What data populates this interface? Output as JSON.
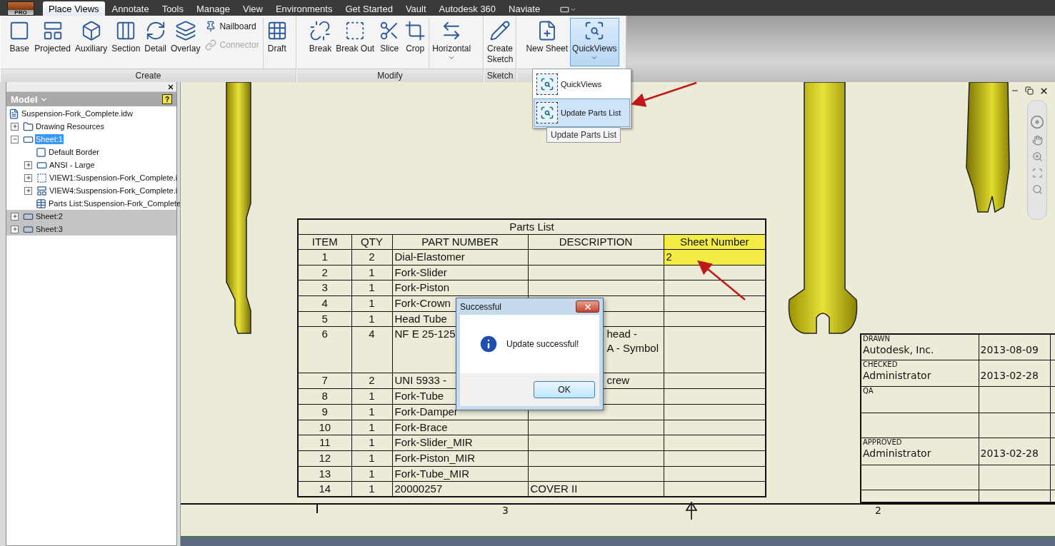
{
  "app_button": {
    "label": "PRO"
  },
  "tabs": [
    {
      "label": "Place Views",
      "selected": true
    },
    {
      "label": "Annotate",
      "selected": false
    },
    {
      "label": "Tools",
      "selected": false
    },
    {
      "label": "Manage",
      "selected": false
    },
    {
      "label": "View",
      "selected": false
    },
    {
      "label": "Environments",
      "selected": false
    },
    {
      "label": "Get Started",
      "selected": false
    },
    {
      "label": "Vault",
      "selected": false
    },
    {
      "label": "Autodesk 360",
      "selected": false
    },
    {
      "label": "Naviate",
      "selected": false
    }
  ],
  "ribbon": {
    "panels": [
      {
        "label": "Create",
        "groups": [
          [
            {
              "label": "Base",
              "kind": "large",
              "pressed": false,
              "disabled": false,
              "dropdown": false
            },
            {
              "label": "Projected",
              "kind": "large",
              "pressed": false,
              "disabled": false,
              "dropdown": false
            },
            {
              "label": "Auxiliary",
              "kind": "large",
              "pressed": false,
              "disabled": false,
              "dropdown": false
            },
            {
              "label": "Section",
              "kind": "large",
              "pressed": false,
              "disabled": false,
              "dropdown": false
            },
            {
              "label": "Detail",
              "kind": "large",
              "pressed": false,
              "disabled": false,
              "dropdown": false
            },
            {
              "label": "Overlay",
              "kind": "large",
              "pressed": false,
              "disabled": false,
              "dropdown": false
            },
            {
              "label": "Nailboard",
              "kind": "small",
              "pressed": false,
              "disabled": false,
              "dropdown": false
            },
            {
              "label": "Connector",
              "kind": "small",
              "pressed": false,
              "disabled": true,
              "dropdown": false
            }
          ],
          [
            {
              "label": "Draft",
              "kind": "large",
              "pressed": false,
              "disabled": false,
              "dropdown": false
            }
          ]
        ]
      },
      {
        "label": "Modify",
        "groups": [
          [
            {
              "label": "Break",
              "kind": "large",
              "pressed": false,
              "disabled": false,
              "dropdown": false
            },
            {
              "label": "Break Out",
              "kind": "large",
              "pressed": false,
              "disabled": false,
              "dropdown": false
            },
            {
              "label": "Slice",
              "kind": "large",
              "pressed": false,
              "disabled": false,
              "dropdown": false
            },
            {
              "label": "Crop",
              "kind": "large",
              "pressed": false,
              "disabled": false,
              "dropdown": false
            }
          ],
          [
            {
              "label": "Horizontal",
              "kind": "large",
              "pressed": false,
              "disabled": false,
              "dropdown": true
            }
          ]
        ]
      },
      {
        "label": "Sketch",
        "groups": [
          [
            {
              "label": "Create\nSketch",
              "kind": "large",
              "pressed": false,
              "disabled": false,
              "dropdown": false
            }
          ]
        ]
      },
      {
        "groups": [
          [
            {
              "label": "New Sheet",
              "kind": "large",
              "pressed": false,
              "disabled": false,
              "dropdown": false
            },
            {
              "label": "QuickViews",
              "kind": "large",
              "pressed": true,
              "disabled": false,
              "dropdown": true
            }
          ]
        ]
      }
    ]
  },
  "quickviews_menu": {
    "items": [
      {
        "label": "QuickViews",
        "selected": false
      },
      {
        "label": "Update Parts List",
        "selected": true
      }
    ],
    "tooltip": "Update Parts List"
  },
  "browser": {
    "title": "Model",
    "help": "?",
    "tree": [
      {
        "label": "Suspension-Fork_Complete.idw",
        "kind": "document",
        "selected": false,
        "children": [
          {
            "label": "Drawing Resources",
            "kind": "folder",
            "selected": false,
            "expanded": false,
            "inactive": false
          },
          {
            "label": "Sheet:1",
            "kind": "sheet",
            "selected": true,
            "expanded": true,
            "inactive": false,
            "children": [
              {
                "label": "Default Border",
                "kind": "border",
                "selected": false
              },
              {
                "label": "ANSI - Large",
                "kind": "titleblock",
                "selected": false,
                "expanded": false
              },
              {
                "label": "VIEW1:Suspension-Fork_Complete.i",
                "kind": "view",
                "selected": false,
                "expanded": false
              },
              {
                "label": "VIEW4:Suspension-Fork_Complete.i",
                "kind": "projected",
                "selected": false,
                "expanded": false
              },
              {
                "label": "Parts List:Suspension-Fork_Complete",
                "kind": "partslist",
                "selected": false
              }
            ]
          },
          {
            "label": "Sheet:2",
            "kind": "sheet",
            "selected": false,
            "expanded": false,
            "inactive": true
          },
          {
            "label": "Sheet:3",
            "kind": "sheet",
            "selected": false,
            "expanded": false,
            "inactive": true
          }
        ]
      }
    ]
  },
  "parts_list": {
    "title": "Parts List",
    "columns": [
      {
        "label": "ITEM",
        "highlighted": false
      },
      {
        "label": "QTY",
        "highlighted": false
      },
      {
        "label": "PART NUMBER",
        "highlighted": false
      },
      {
        "label": "DESCRIPTION",
        "highlighted": false
      },
      {
        "label": "Sheet Number",
        "highlighted": true
      }
    ],
    "rows": [
      {
        "item": "1",
        "qty": "2",
        "part_number": "Dial-Elastomer",
        "sheet_number": "2",
        "highlighted": true
      },
      {
        "item": "2",
        "qty": "1",
        "part_number": "Fork-Slider",
        "highlighted": false
      },
      {
        "item": "3",
        "qty": "1",
        "part_number": "Fork-Piston",
        "highlighted": false
      },
      {
        "item": "4",
        "qty": "1",
        "part_number": "Fork-Crown",
        "highlighted": false
      },
      {
        "item": "5",
        "qty": "1",
        "part_number": "Head Tube",
        "highlighted": false
      },
      {
        "item": "6",
        "qty": "4",
        "part_number": "NF E 25-125",
        "description": "head -\nA - Symbol",
        "highlighted": false,
        "partly_hidden": true
      },
      {
        "item": "7",
        "qty": "2",
        "part_number": "UNI 5933 -",
        "description": "crew",
        "highlighted": false,
        "partly_hidden": true
      },
      {
        "item": "8",
        "qty": "1",
        "part_number": "Fork-Tube",
        "highlighted": false
      },
      {
        "item": "9",
        "qty": "1",
        "part_number": "Fork-Damper",
        "highlighted": false
      },
      {
        "item": "10",
        "qty": "1",
        "part_number": "Fork-Brace",
        "highlighted": false
      },
      {
        "item": "11",
        "qty": "1",
        "part_number": "Fork-Slider_MIR",
        "highlighted": false
      },
      {
        "item": "12",
        "qty": "1",
        "part_number": "Fork-Piston_MIR",
        "highlighted": false
      },
      {
        "item": "13",
        "qty": "1",
        "part_number": "Fork-Tube_MIR",
        "highlighted": false
      },
      {
        "item": "14",
        "qty": "1",
        "part_number": "20000257",
        "description": "COVER II",
        "highlighted": false,
        "partly_hidden": false
      }
    ]
  },
  "title_block": {
    "rows": [
      {
        "caption": "DRAWN",
        "name": "Autodesk, Inc.",
        "date": "2013-08-09"
      },
      {
        "caption": "CHECKED",
        "name": "Administrator",
        "date": "2013-02-28"
      },
      {
        "caption": "QA"
      },
      {},
      {
        "caption": "APPROVED",
        "name": "Administrator",
        "date": "2013-02-28"
      },
      {},
      {}
    ]
  },
  "zone_labels": [
    "3",
    "2"
  ],
  "dialog": {
    "title": "Successful",
    "message": "Update successful!",
    "button": "OK"
  }
}
